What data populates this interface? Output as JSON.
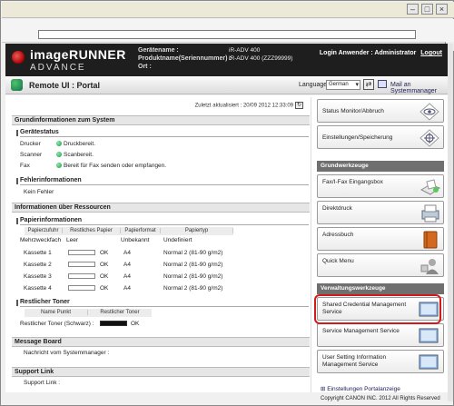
{
  "header": {
    "logo_line1": "imageRUNNER",
    "logo_line2": "ADVANCE",
    "device_name_label": "Gerätename :",
    "device_name_value": "iR-ADV 400",
    "product_label": "Produktname(Seriennummer) :",
    "product_value": "iR-ADV 400 (ZZZ99999)",
    "location_label": "Ort :",
    "login_text": "Login Anwender : Administrator",
    "logout_label": "Logout"
  },
  "nav": {
    "title": "Remote UI : Portal",
    "language_label": "Language",
    "language_value": "German",
    "mail_link": "Mail an Systemmanager"
  },
  "main": {
    "last_updated": "Zuletzt aktualisiert : 20/09 2012 12:33:09",
    "basic_info_title": "Grundinformationen zum System",
    "device_status_head": "Gerätestatus",
    "status_rows": [
      {
        "label": "Drucker",
        "value": "Druckbereit."
      },
      {
        "label": "Scanner",
        "value": "Scanbereit."
      },
      {
        "label": "Fax",
        "value": "Bereit für Fax senden oder empfangen."
      }
    ],
    "error_head": "Fehlerinformationen",
    "error_value": "Kein Fehler",
    "resources_title": "Informationen über Ressourcen",
    "paper_head": "Papierinformationen",
    "paper_cols": [
      "Papierzufuhr",
      "Restliches Papier",
      "Papierformat",
      "Papiertyp"
    ],
    "paper_rows": [
      {
        "source": "Mehrzweckfach",
        "remaining": "Leer",
        "format": "Unbekannt",
        "type": "Undefiniert",
        "bar": false
      },
      {
        "source": "Kassette 1",
        "remaining": "OK",
        "format": "A4",
        "type": "Normal 2 (81-90 g/m2)",
        "bar": true
      },
      {
        "source": "Kassette 2",
        "remaining": "OK",
        "format": "A4",
        "type": "Normal 2 (81-90 g/m2)",
        "bar": true
      },
      {
        "source": "Kassette 3",
        "remaining": "OK",
        "format": "A4",
        "type": "Normal 2 (81-90 g/m2)",
        "bar": true
      },
      {
        "source": "Kassette 4",
        "remaining": "OK",
        "format": "A4",
        "type": "Normal 2 (81-90 g/m2)",
        "bar": true
      }
    ],
    "toner_head": "Restlicher Toner",
    "toner_cols": [
      "Name Punkt",
      "Restlicher Toner"
    ],
    "toner_row": {
      "name": "Restlicher Toner (Schwarz) :",
      "value": "OK"
    },
    "message_title": "Message Board",
    "message_label": "Nachricht vom Systemmanager :",
    "support_title": "Support Link",
    "support_label": "Support Link :"
  },
  "right": {
    "btn_status": "Status Monitor/Abbruch",
    "btn_settings": "Einstellungen/Speicherung",
    "sec_basic": "Grundwerkzeuge",
    "btn_fax": "Fax/I-Fax Eingangsbox",
    "btn_direct": "Direktdruck",
    "btn_address": "Adressbuch",
    "btn_quick": "Quick Menu",
    "sec_admin": "Verwaltungswerkzeuge",
    "btn_shared_1": "Shared Credential Management",
    "btn_shared_2": "Service",
    "btn_service": "Service Management Service",
    "btn_user_1": "User Setting Information",
    "btn_user_2": "Management Service"
  },
  "footer": {
    "portal_settings": "Einstellungen Portalanzeige",
    "copyright": "Copyright CANON INC. 2012 All Rights Reserved"
  },
  "colors": {
    "highlight": "#d21a1a",
    "status_ok": "#1a9a4a",
    "header_bg": "#1e1e1e"
  }
}
